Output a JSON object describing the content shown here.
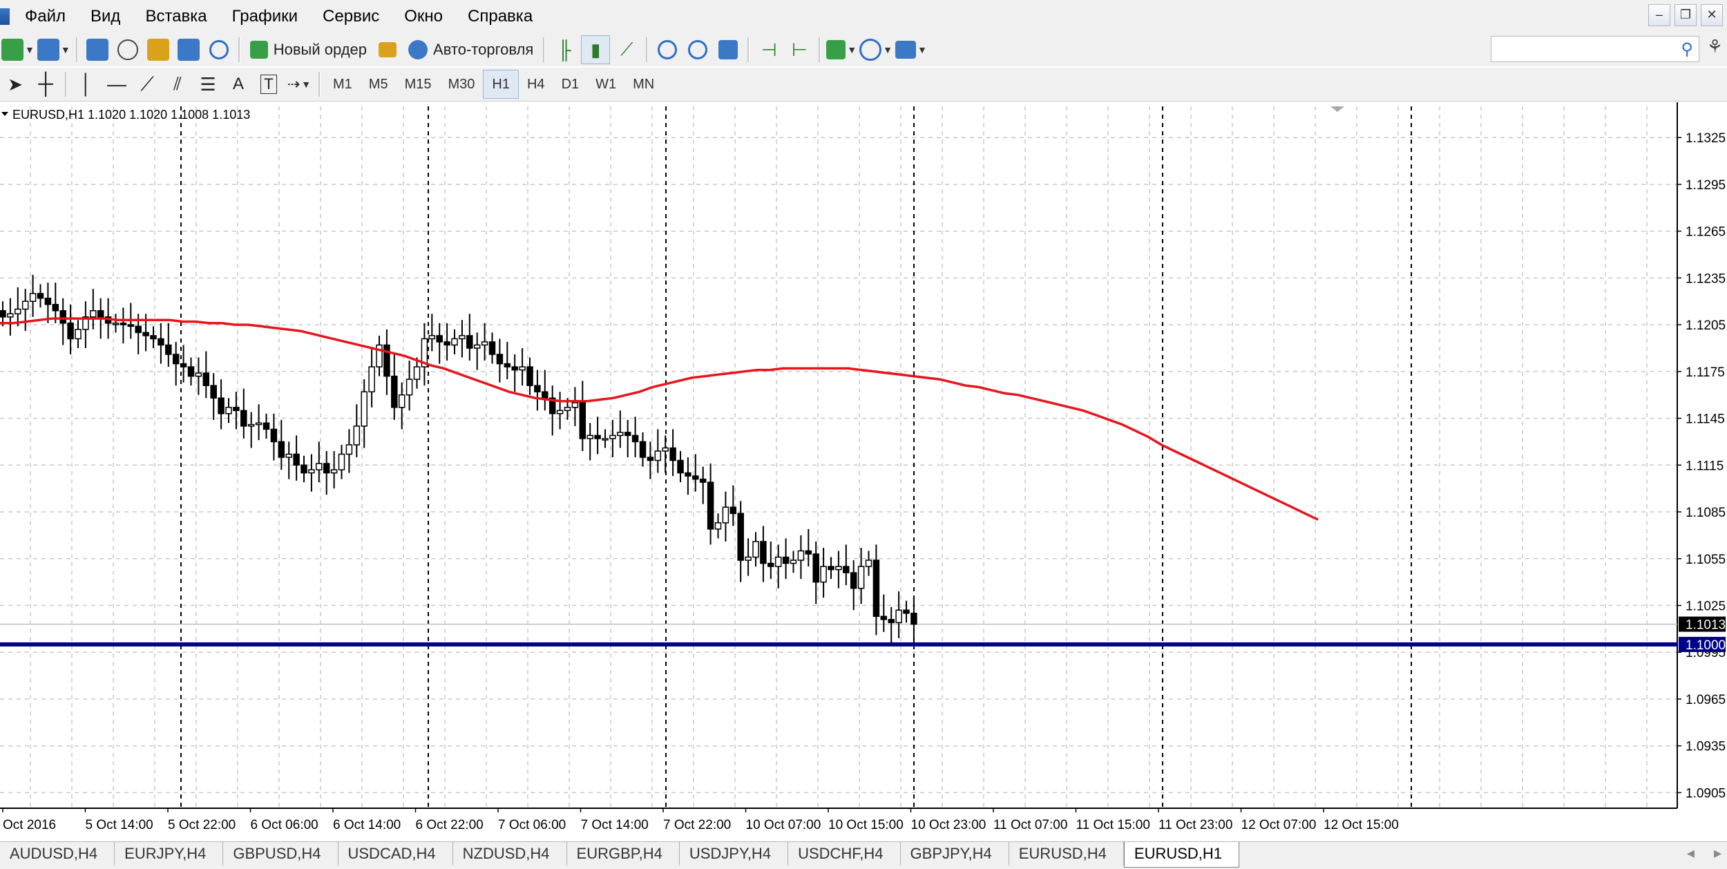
{
  "menu": [
    "Файл",
    "Вид",
    "Вставка",
    "Графики",
    "Сервис",
    "Окно",
    "Справка"
  ],
  "toolbar": {
    "new_order_label": "Новый ордер",
    "auto_trading_label": "Авто-торговля",
    "timeframes": [
      "M1",
      "M5",
      "M15",
      "M30",
      "H1",
      "H4",
      "D1",
      "W1",
      "MN"
    ],
    "active_timeframe": "H1"
  },
  "chart": {
    "header": "EURUSD,H1  1.1020 1.1020 1.1008 1.1013",
    "current_price_label": "1.1013",
    "level_label": "1.1000",
    "price_axis": [
      "1.1325",
      "1.1295",
      "1.1265",
      "1.1235",
      "1.1205",
      "1.1175",
      "1.1145",
      "1.1115",
      "1.1085",
      "1.1055",
      "1.1025",
      "1.0995",
      "1.0965",
      "1.0935",
      "1.0905"
    ],
    "time_axis": [
      "Oct 2016",
      "5 Oct 14:00",
      "5 Oct 22:00",
      "6 Oct 06:00",
      "6 Oct 14:00",
      "6 Oct 22:00",
      "7 Oct 06:00",
      "7 Oct 14:00",
      "7 Oct 22:00",
      "10 Oct 07:00",
      "10 Oct 15:00",
      "10 Oct 23:00",
      "11 Oct 07:00",
      "11 Oct 15:00",
      "11 Oct 23:00",
      "12 Oct 07:00",
      "12 Oct 15:00"
    ],
    "colors": {
      "ma": "#e8141b",
      "level": "#00008b",
      "grid": "#c8c8c8",
      "candle": "#000000"
    }
  },
  "chart_data": {
    "type": "candlestick",
    "symbol": "EURUSD",
    "timeframe": "H1",
    "ylim": [
      1.0895,
      1.1345
    ],
    "last": {
      "open": 1.102,
      "high": 1.102,
      "low": 1.1008,
      "close": 1.1013
    },
    "horizontal_level": 1.1,
    "close_series": [
      1.121,
      1.1212,
      1.1215,
      1.122,
      1.1225,
      1.1222,
      1.1218,
      1.1214,
      1.1206,
      1.1196,
      1.1202,
      1.121,
      1.1214,
      1.121,
      1.1206,
      1.1206,
      1.1205,
      1.1204,
      1.12,
      1.1198,
      1.1196,
      1.1192,
      1.1186,
      1.118,
      1.1178,
      1.1172,
      1.1174,
      1.1166,
      1.1158,
      1.1148,
      1.1152,
      1.115,
      1.114,
      1.1141,
      1.1142,
      1.1138,
      1.113,
      1.112,
      1.1122,
      1.1115,
      1.111,
      1.1112,
      1.1116,
      1.111,
      1.1112,
      1.1122,
      1.1128,
      1.114,
      1.1162,
      1.1178,
      1.1192,
      1.1172,
      1.1152,
      1.116,
      1.117,
      1.1178,
      1.1196,
      1.1198,
      1.1194,
      1.1192,
      1.1196,
      1.1198,
      1.119,
      1.1192,
      1.1194,
      1.1186,
      1.118,
      1.1178,
      1.1176,
      1.1178,
      1.1166,
      1.1162,
      1.1158,
      1.1148,
      1.115,
      1.1152,
      1.1155,
      1.1132,
      1.1134,
      1.1132,
      1.1132,
      1.1134,
      1.1136,
      1.1134,
      1.113,
      1.112,
      1.1118,
      1.1124,
      1.1126,
      1.1118,
      1.111,
      1.1108,
      1.1106,
      1.1104,
      1.1074,
      1.1078,
      1.1088,
      1.1084,
      1.1054,
      1.1056,
      1.1066,
      1.1052,
      1.105,
      1.1056,
      1.1052,
      1.1054,
      1.106,
      1.1058,
      1.104,
      1.105,
      1.1048,
      1.105,
      1.1046,
      1.1036,
      1.105,
      1.1054,
      1.1018,
      1.1016,
      1.1014,
      1.1022,
      1.102,
      1.1013
    ],
    "ma_series": [
      1.1206,
      1.1206,
      1.1207,
      1.1208,
      1.1209,
      1.1209,
      1.1209,
      1.1209,
      1.1209,
      1.1208,
      1.1208,
      1.1208,
      1.1208,
      1.1208,
      1.1207,
      1.1207,
      1.1206,
      1.1206,
      1.1205,
      1.1205,
      1.1204,
      1.1203,
      1.1202,
      1.1201,
      1.1199,
      1.1197,
      1.1195,
      1.1193,
      1.1191,
      1.1189,
      1.1187,
      1.1185,
      1.1182,
      1.1179,
      1.1177,
      1.1174,
      1.1171,
      1.1168,
      1.1165,
      1.1162,
      1.116,
      1.1158,
      1.1157,
      1.1156,
      1.1156,
      1.1156,
      1.1157,
      1.1158,
      1.116,
      1.1162,
      1.1165,
      1.1167,
      1.1169,
      1.1171,
      1.1172,
      1.1173,
      1.1174,
      1.1175,
      1.1176,
      1.1176,
      1.1177,
      1.1177,
      1.1177,
      1.1177,
      1.1177,
      1.1177,
      1.1176,
      1.1175,
      1.1174,
      1.1173,
      1.1172,
      1.1171,
      1.117,
      1.1168,
      1.1166,
      1.1165,
      1.1163,
      1.1161,
      1.116,
      1.1158,
      1.1156,
      1.1154,
      1.1152,
      1.115,
      1.1147,
      1.1144,
      1.1141,
      1.1137,
      1.1133,
      1.1128,
      1.1124,
      1.112,
      1.1116,
      1.1112,
      1.1108,
      1.1104,
      1.11,
      1.1096,
      1.1092,
      1.1088,
      1.1084,
      1.108
    ],
    "vertical_separators": [
      "5 Oct 22:00",
      "6 Oct 22:00",
      "7 Oct 22:00",
      "10 Oct 23:00",
      "11 Oct 23:00",
      "12 Oct 15:00"
    ]
  },
  "tabs": [
    "AUDUSD,H4",
    "EURJPY,H4",
    "GBPUSD,H4",
    "USDCAD,H4",
    "NZDUSD,H4",
    "EURGBP,H4",
    "USDJPY,H4",
    "USDCHF,H4",
    "GBPJPY,H4",
    "EURUSD,H4",
    "EURUSD,H1"
  ],
  "active_tab": "EURUSD,H1"
}
